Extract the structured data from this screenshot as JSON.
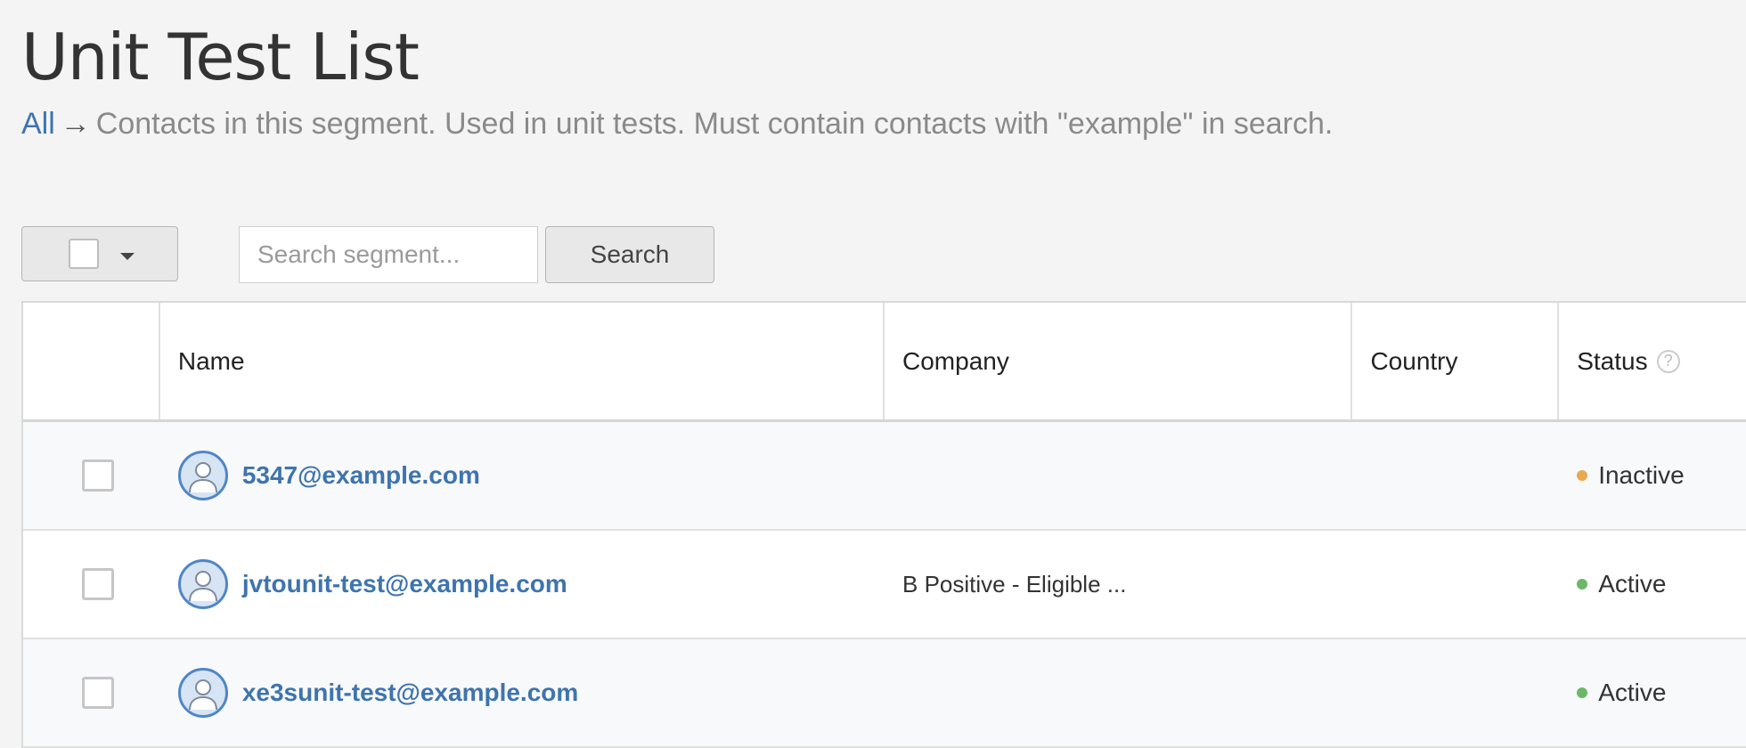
{
  "page": {
    "title": "Unit Test List",
    "breadcrumb_link": "All",
    "breadcrumb_arrow": "→",
    "description": "Contacts in this segment. Used in unit tests. Must contain contacts with \"example\" in search."
  },
  "toolbar": {
    "search_placeholder": "Search segment...",
    "search_value": "",
    "search_button": "Search"
  },
  "table": {
    "columns": [
      "Name",
      "Company",
      "Country",
      "Status"
    ],
    "help_icon": "?",
    "rows": [
      {
        "email": "5347@example.com",
        "company": "",
        "country": "",
        "status": "Inactive",
        "status_color": "#e8a94f"
      },
      {
        "email": "jvtounit-test@example.com",
        "company": "B Positive - Eligible ...",
        "country": "",
        "status": "Active",
        "status_color": "#6ab866"
      },
      {
        "email": "xe3sunit-test@example.com",
        "company": "",
        "country": "",
        "status": "Active",
        "status_color": "#6ab866"
      }
    ]
  },
  "icons": {
    "avatar": "user-avatar-icon",
    "caret": "caret-down-icon",
    "help": "question-circle-icon"
  },
  "colors": {
    "link": "#3e74ad",
    "active": "#6ab866",
    "inactive": "#e8a94f"
  }
}
